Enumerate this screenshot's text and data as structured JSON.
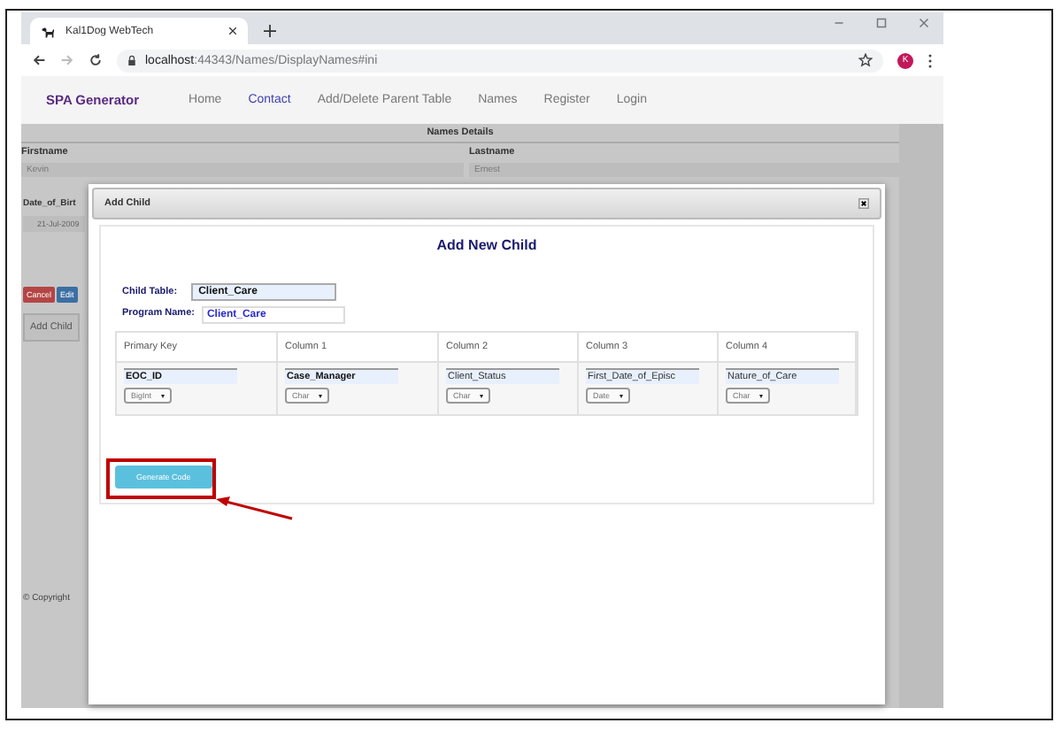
{
  "browser": {
    "tab_title": "Kal1Dog WebTech",
    "url_host": "localhost",
    "url_path": ":44343/Names/DisplayNames#ini",
    "avatar_letter": "K"
  },
  "navbar": {
    "brand": "SPA Generator",
    "links": [
      {
        "label": "Home",
        "selected": false
      },
      {
        "label": "Contact",
        "selected": true
      },
      {
        "label": "Add/Delete Parent Table",
        "selected": false
      },
      {
        "label": "Names",
        "selected": false
      },
      {
        "label": "Register",
        "selected": false
      },
      {
        "label": "Login",
        "selected": false
      }
    ]
  },
  "page": {
    "section_title": "Names Details",
    "columns": [
      "Firstname",
      "Lastname"
    ],
    "values": [
      "Kevin",
      "Ernest"
    ],
    "dob_label": "Date_of_Birt",
    "dob_value": "21-Jul-2009",
    "buttons": [
      {
        "label": "Cancel",
        "kind": "danger"
      },
      {
        "label": "Edit",
        "kind": "primary"
      }
    ],
    "add_child": "Add Child",
    "footer": "© Copyright"
  },
  "dialog": {
    "title": "Add Child",
    "heading": "Add New Child",
    "child_table": {
      "label": "Child Table:",
      "value": "Client_Care"
    },
    "program_name": {
      "label": "Program Name:",
      "value": "Client_Care"
    },
    "columns": [
      {
        "header": "Primary Key",
        "value": "EOC_ID",
        "bold": true,
        "type": "BigInt"
      },
      {
        "header": "Column 1",
        "value": "Case_Manager",
        "bold": true,
        "type": "Char"
      },
      {
        "header": "Column 2",
        "value": "Client_Status",
        "bold": false,
        "type": "Char"
      },
      {
        "header": "Column 3",
        "value": "First_Date_of_Episc",
        "bold": false,
        "type": "Date"
      },
      {
        "header": "Column 4",
        "value": "Nature_of_Care",
        "bold": false,
        "type": "Char"
      }
    ],
    "generate_button": "Generate Code"
  }
}
